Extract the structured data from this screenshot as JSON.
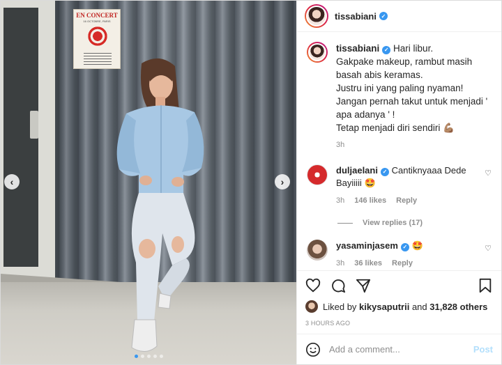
{
  "post": {
    "author": "tissabiani",
    "verified": true,
    "media": {
      "poster_title": "EN CONCERT",
      "poster_subtitle": "16 OCTOBRE, PARIS",
      "slide_count": 5,
      "active_slide": 1,
      "prev_icon": "chevron-left-icon",
      "next_icon": "chevron-right-icon"
    },
    "caption": {
      "username": "tissabiani",
      "text": "Hari libur.\nGakpake makeup, rambut masih basah abis keramas.\nJustru ini yang paling nyaman!\nJangan pernah takut untuk menjadi ' apa adanya ' !\nTetap menjadi diri sendiri 💪🏽",
      "time": "3h"
    },
    "comments": [
      {
        "username": "duljaelani",
        "verified": true,
        "text": "Cantiknyaaa Dede Bayiiiii 🤩",
        "time": "3h",
        "likes": "146 likes",
        "reply": "Reply"
      },
      {
        "username": "yasaminjasem",
        "verified": true,
        "text": "🤩",
        "time": "3h",
        "likes": "36 likes",
        "reply": "Reply"
      }
    ],
    "view_replies": "View replies (17)",
    "liked_by_prefix": "Liked by ",
    "liked_by_user": "kikysaputrii",
    "liked_by_mid": " and ",
    "liked_by_count": "31,828 others",
    "timestamp": "3 HOURS AGO",
    "add_comment": {
      "placeholder": "Add a comment...",
      "post_label": "Post"
    },
    "colors": {
      "verified": "#3897f0",
      "muted": "#8e8e8e",
      "post_disabled": "#b2dffc"
    }
  }
}
